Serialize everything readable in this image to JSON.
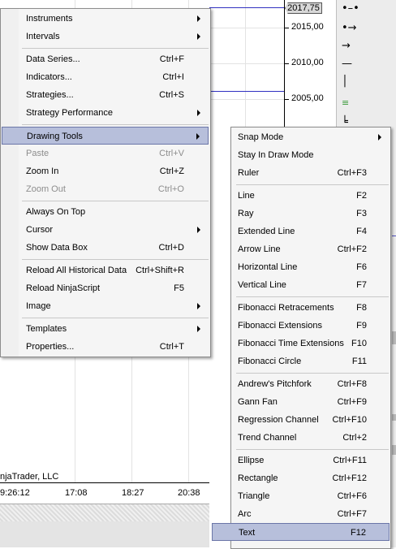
{
  "price_axis": {
    "current_price": "2017,75",
    "labels": [
      "2015,00",
      "2010,00",
      "2005,00"
    ]
  },
  "time_axis": {
    "labels": [
      "9:26:12",
      "17:08",
      "18:27",
      "20:38"
    ]
  },
  "copyright": "njaTrader, LLC",
  "main_menu": {
    "items": [
      {
        "label": "Instruments",
        "shortcut": "",
        "submenu": true
      },
      {
        "label": "Intervals",
        "shortcut": "",
        "submenu": true
      },
      {
        "label": "Data Series...",
        "shortcut": "Ctrl+F"
      },
      {
        "label": "Indicators...",
        "shortcut": "Ctrl+I"
      },
      {
        "label": "Strategies...",
        "shortcut": "Ctrl+S"
      },
      {
        "label": "Strategy Performance",
        "shortcut": "",
        "submenu": true
      },
      {
        "label": "Drawing Tools",
        "shortcut": "",
        "submenu": true
      },
      {
        "label": "Paste",
        "shortcut": "Ctrl+V"
      },
      {
        "label": "Zoom In",
        "shortcut": "Ctrl+Z"
      },
      {
        "label": "Zoom Out",
        "shortcut": "Ctrl+O"
      },
      {
        "label": "Always On Top",
        "shortcut": ""
      },
      {
        "label": "Cursor",
        "shortcut": "",
        "submenu": true
      },
      {
        "label": "Show Data Box",
        "shortcut": "Ctrl+D"
      },
      {
        "label": "Reload All Historical Data",
        "shortcut": "Ctrl+Shift+R"
      },
      {
        "label": "Reload NinjaScript",
        "shortcut": "F5"
      },
      {
        "label": "Image",
        "shortcut": "",
        "submenu": true
      },
      {
        "label": "Templates",
        "shortcut": "",
        "submenu": true
      },
      {
        "label": "Properties...",
        "shortcut": "Ctrl+T"
      }
    ]
  },
  "drawing_menu": {
    "items": [
      {
        "label": "Snap Mode",
        "shortcut": "",
        "submenu": true
      },
      {
        "label": "Stay In Draw Mode",
        "shortcut": ""
      },
      {
        "label": "Ruler",
        "shortcut": "Ctrl+F3"
      },
      {
        "label": "Line",
        "shortcut": "F2"
      },
      {
        "label": "Ray",
        "shortcut": "F3"
      },
      {
        "label": "Extended Line",
        "shortcut": "F4"
      },
      {
        "label": "Arrow Line",
        "shortcut": "Ctrl+F2"
      },
      {
        "label": "Horizontal Line",
        "shortcut": "F6"
      },
      {
        "label": "Vertical Line",
        "shortcut": "F7"
      },
      {
        "label": "Fibonacci Retracements",
        "shortcut": "F8"
      },
      {
        "label": "Fibonacci Extensions",
        "shortcut": "F9"
      },
      {
        "label": "Fibonacci Time Extensions",
        "shortcut": "F10"
      },
      {
        "label": "Fibonacci Circle",
        "shortcut": "F11"
      },
      {
        "label": "Andrew's Pitchfork",
        "shortcut": "Ctrl+F8"
      },
      {
        "label": "Gann Fan",
        "shortcut": "Ctrl+F9"
      },
      {
        "label": "Regression Channel",
        "shortcut": "Ctrl+F10"
      },
      {
        "label": "Trend Channel",
        "shortcut": "Ctrl+2"
      },
      {
        "label": "Ellipse",
        "shortcut": "Ctrl+F11"
      },
      {
        "label": "Rectangle",
        "shortcut": "Ctrl+F12"
      },
      {
        "label": "Triangle",
        "shortcut": "Ctrl+F6"
      },
      {
        "label": "Arc",
        "shortcut": "Ctrl+F7"
      },
      {
        "label": "Text",
        "shortcut": "F12"
      }
    ]
  },
  "colors": {
    "highlight": "#b7bfdb",
    "menu_bg": "#f5f5f5",
    "disabled_text": "#8d8d8d"
  }
}
